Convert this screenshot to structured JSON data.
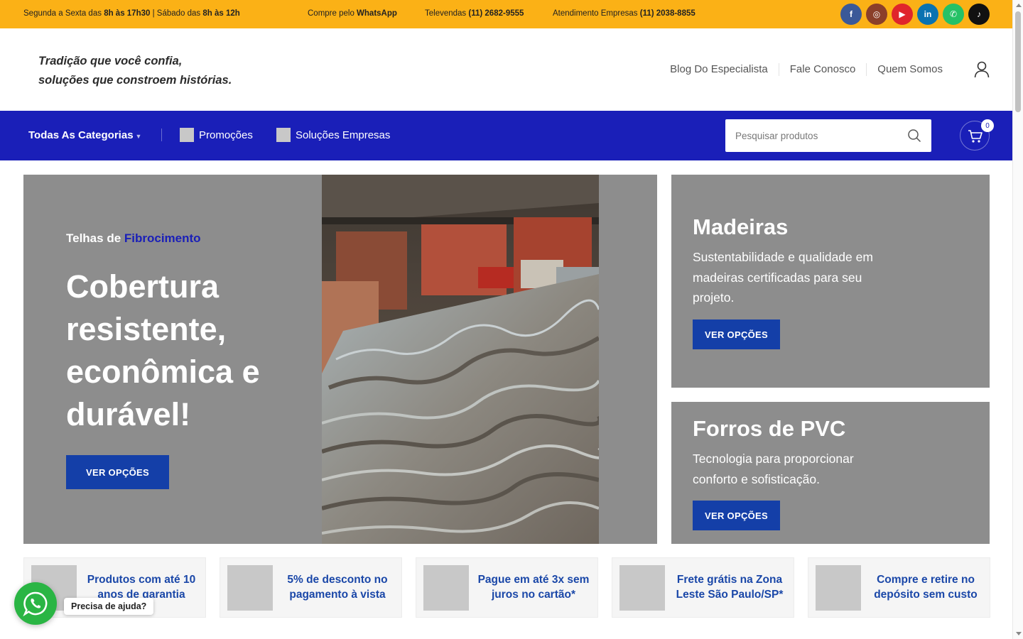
{
  "topbar": {
    "hours_prefix": "Segunda a Sexta das",
    "hours_weekday": "8h às 17h30",
    "hours_mid": "| Sábado das",
    "hours_saturday": "8h às 12h",
    "whatsapp_prefix": "Compre pelo",
    "whatsapp_label": "WhatsApp",
    "televendas_prefix": "Televendas",
    "televendas_phone": "(11) 2682-9555",
    "empresas_prefix": "Atendimento Empresas",
    "empresas_phone": "(11) 2038-8855",
    "socials": [
      {
        "icon": "facebook-icon",
        "glyph": "f",
        "color": "#3b5998"
      },
      {
        "icon": "instagram-icon",
        "glyph": "◎",
        "color": "#8a3f2a"
      },
      {
        "icon": "youtube-icon",
        "glyph": "▶",
        "color": "#e0252b"
      },
      {
        "icon": "linkedin-icon",
        "glyph": "in",
        "color": "#0a72b1"
      },
      {
        "icon": "whatsapp-icon",
        "glyph": "✆",
        "color": "#25c166"
      },
      {
        "icon": "tiktok-icon",
        "glyph": "♪",
        "color": "#111111"
      }
    ]
  },
  "header": {
    "tagline_line1": "Tradição que você confia,",
    "tagline_line2": "soluções que constroem histórias.",
    "nav": [
      "Blog Do Especialista",
      "Fale Conosco",
      "Quem Somos"
    ],
    "account_icon": "user-icon"
  },
  "mainnav": {
    "categories_label": "Todas As Categorias",
    "items": [
      "Promoções",
      "Soluções Empresas"
    ],
    "search_placeholder": "Pesquisar produtos",
    "search_icon": "search-icon",
    "cart_icon": "cart-icon",
    "cart_count": "0"
  },
  "hero": {
    "kicker_prefix": "Telhas de",
    "kicker_highlight": "Fibrocimento",
    "headline": "Cobertura resistente, econômica e durável!",
    "button": "VER OPÇÕES"
  },
  "side_banners": [
    {
      "title": "Madeiras",
      "text": "Sustentabilidade e qualidade em madeiras certificadas para seu projeto.",
      "button": "VER OPÇÕES"
    },
    {
      "title": "Forros de PVC",
      "text": "Tecnologia para proporcionar conforto e sofisticação.",
      "button": "VER OPÇÕES"
    }
  ],
  "features": [
    "Produtos com até 10 anos de garantia",
    "5% de desconto no pagamento à vista",
    "Pague em até 3x sem juros no cartão*",
    "Frete grátis na Zona Leste São Paulo/SP*",
    "Compre e retire no depósito sem custo"
  ],
  "whatsapp_chat": {
    "tooltip": "Precisa de ajuda?",
    "icon": "whatsapp-icon"
  },
  "colors": {
    "topbar": "#fbb116",
    "nav": "#1a1fb8",
    "button": "#143fa8",
    "banner": "#8d8d8d",
    "feature_text": "#1a47a8"
  }
}
